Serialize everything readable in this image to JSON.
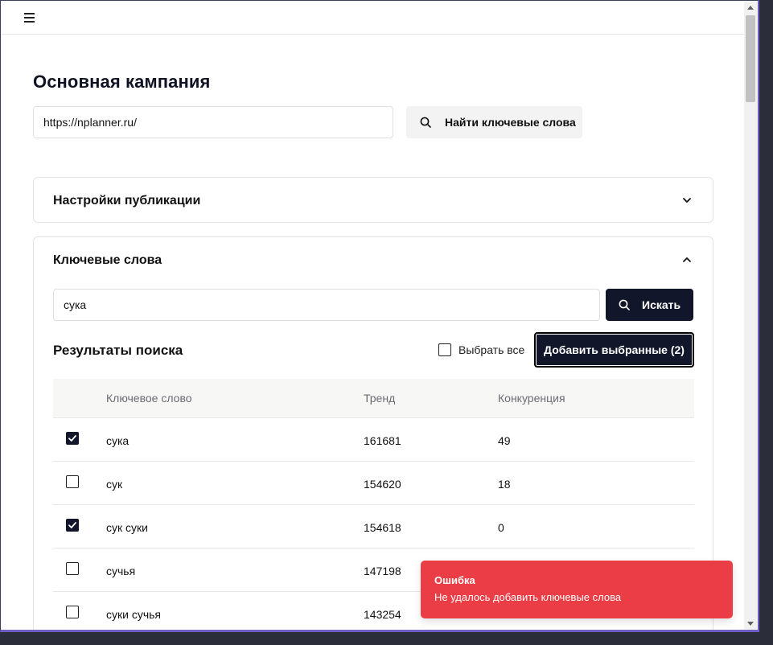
{
  "header": {
    "menu_icon": "hamburger-icon"
  },
  "page": {
    "title": "Основная кампания"
  },
  "site": {
    "url_value": "https://nplanner.ru/",
    "find_button_label": "Найти ключевые слова",
    "find_button_icon": "search-icon"
  },
  "publication_settings": {
    "title": "Настройки публикации",
    "expanded": false
  },
  "keywords": {
    "title": "Ключевые слова",
    "expanded": true,
    "search_value": "сука",
    "search_button_label": "Искать",
    "results_title": "Результаты поиска",
    "select_all_label": "Выбрать все",
    "add_selected_label": "Добавить выбранные (2)",
    "columns": [
      "Ключевое слово",
      "Тренд",
      "Конкуренция"
    ],
    "rows": [
      {
        "keyword": "сука",
        "trend": "161681",
        "competition": "49",
        "checked": true
      },
      {
        "keyword": "сук",
        "trend": "154620",
        "competition": "18",
        "checked": false
      },
      {
        "keyword": "сук суки",
        "trend": "154618",
        "competition": "0",
        "checked": true
      },
      {
        "keyword": "сучья",
        "trend": "147198",
        "competition": "",
        "checked": false
      },
      {
        "keyword": "суки сучья",
        "trend": "143254",
        "competition": "",
        "checked": false
      }
    ]
  },
  "toast": {
    "title": "Ошибка",
    "message": "Не удалось добавить ключевые слова",
    "color": "#ea3d45"
  },
  "colors": {
    "primary": "#11162a",
    "error": "#ea3d45"
  }
}
